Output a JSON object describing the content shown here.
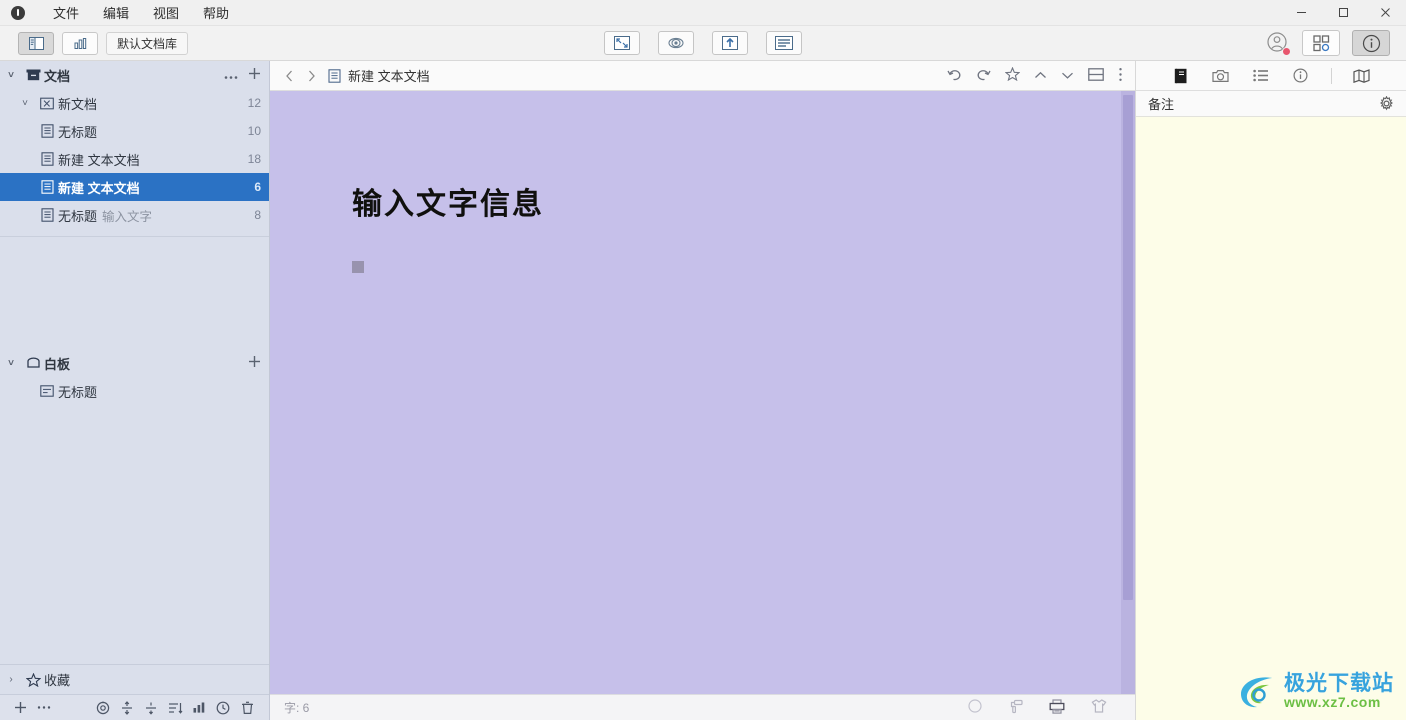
{
  "titlebar": {
    "logo_icon": "app-logo-icon",
    "menus": [
      {
        "label": "文件",
        "name": "menu-file"
      },
      {
        "label": "编辑",
        "name": "menu-edit"
      },
      {
        "label": "视图",
        "name": "menu-view"
      },
      {
        "label": "帮助",
        "name": "menu-help"
      }
    ],
    "window_controls": {
      "minimize": "—",
      "maximize": "☐",
      "close": "✕"
    }
  },
  "toolbar": {
    "sidebar_toggle_icon": "sidebar-layout-icon",
    "chart_toggle_icon": "bar-chart-icon",
    "library_label": "默认文档库",
    "center_buttons": [
      {
        "name": "fit-screen-button",
        "icon": "fit-screen-icon"
      },
      {
        "name": "focus-mode-button",
        "icon": "eye-focus-icon"
      },
      {
        "name": "export-button",
        "icon": "upload-arrow-icon"
      },
      {
        "name": "outline-button",
        "icon": "document-lines-icon"
      }
    ],
    "account_icon": "account-avatar-icon",
    "apps_icon": "apps-grid-icon",
    "info_icon": "info-circle-icon"
  },
  "sidebar": {
    "sections": [
      {
        "name": "section-documents",
        "label": "文档",
        "icon": "archive-box-icon",
        "expanded": true,
        "chevron": "˅",
        "actions": [
          "more-dots-icon",
          "add-plus-icon"
        ],
        "items": [
          {
            "name": "tree-item-new-doc-group",
            "label": "新文档",
            "sublabel": "",
            "count": "12",
            "icon": "folder-doc-icon",
            "chevron": "˅",
            "depth": 0,
            "selected": false
          },
          {
            "name": "tree-item-untitled-child",
            "label": "无标题",
            "sublabel": "",
            "count": "10",
            "icon": "text-doc-icon",
            "chevron": "",
            "depth": 1,
            "selected": false
          },
          {
            "name": "tree-item-new-text-doc-1",
            "label": "新建 文本文档",
            "sublabel": "",
            "count": "18",
            "icon": "text-doc-icon",
            "chevron": "",
            "depth": 0,
            "selected": false
          },
          {
            "name": "tree-item-new-text-doc-2",
            "label": "新建 文本文档",
            "sublabel": "",
            "count": "6",
            "icon": "text-doc-icon",
            "chevron": "",
            "depth": 0,
            "selected": true
          },
          {
            "name": "tree-item-untitled-input",
            "label": "无标题",
            "sublabel": "输入文字",
            "count": "8",
            "icon": "text-doc-icon",
            "chevron": "",
            "depth": 0,
            "selected": false
          }
        ]
      },
      {
        "name": "section-whiteboard",
        "label": "白板",
        "icon": "whiteboard-icon",
        "expanded": true,
        "chevron": "˅",
        "actions": [
          "add-plus-icon"
        ],
        "items": [
          {
            "name": "tree-item-whiteboard-untitled",
            "label": "无标题",
            "sublabel": "",
            "count": "",
            "icon": "whiteboard-item-icon",
            "chevron": "",
            "depth": 0,
            "selected": false
          }
        ]
      }
    ],
    "favorites": {
      "name": "section-favorites",
      "label": "收藏",
      "icon": "star-icon",
      "chevron": "›"
    },
    "bottom_bar": [
      {
        "name": "add-button",
        "icon": "plus-icon"
      },
      {
        "name": "more-button",
        "icon": "ellipsis-icon"
      },
      {
        "name": "target-button",
        "icon": "target-icon"
      },
      {
        "name": "split-vertical-button",
        "icon": "split-vertical-icon"
      },
      {
        "name": "split-horizontal-button",
        "icon": "split-horizontal-icon"
      },
      {
        "name": "sort-button",
        "icon": "sort-list-icon"
      },
      {
        "name": "stats-button",
        "icon": "bar-chart-icon"
      },
      {
        "name": "history-button",
        "icon": "clock-icon"
      },
      {
        "name": "trash-button",
        "icon": "trash-icon"
      }
    ]
  },
  "document": {
    "nav_back_icon": "chevron-left-icon",
    "nav_forward_icon": "chevron-right-icon",
    "title_icon": "text-doc-icon",
    "title": "新建 文本文档",
    "actions": [
      {
        "name": "undo-button",
        "icon": "undo-icon"
      },
      {
        "name": "redo-button",
        "icon": "redo-icon"
      },
      {
        "name": "favorite-button",
        "icon": "star-icon"
      },
      {
        "name": "prev-button",
        "icon": "chevron-up-icon"
      },
      {
        "name": "next-button",
        "icon": "chevron-down-icon"
      },
      {
        "name": "split-pane-button",
        "icon": "split-pane-icon"
      },
      {
        "name": "more-menu-button",
        "icon": "vertical-dots-icon"
      }
    ],
    "heading": "输入文字信息",
    "background_color": "#c6c0ea",
    "cursor_block_color": "#9893ae"
  },
  "statusbar": {
    "word_count": "字: 6",
    "icons": [
      {
        "name": "circle-button",
        "icon": "circle-icon"
      },
      {
        "name": "paint-roller-button",
        "icon": "paint-roller-icon"
      },
      {
        "name": "print-button",
        "icon": "printer-icon"
      },
      {
        "name": "theme-button",
        "icon": "shirt-icon"
      }
    ]
  },
  "rightpanel": {
    "tabs": [
      {
        "name": "tab-notebook",
        "icon": "notebook-icon",
        "active": true
      },
      {
        "name": "tab-camera",
        "icon": "camera-icon",
        "active": false
      },
      {
        "name": "tab-list",
        "icon": "list-icon",
        "active": false
      },
      {
        "name": "tab-info",
        "icon": "info-circle-icon",
        "active": false
      },
      {
        "name": "tab-map",
        "icon": "map-icon",
        "active": false
      }
    ],
    "title": "备注",
    "settings_icon": "gear-icon",
    "background_color": "#fdfde8"
  },
  "watermark": {
    "main": "极光下载站",
    "sub": "www.xz7.com",
    "logo_icon": "swirl-logo-icon"
  }
}
